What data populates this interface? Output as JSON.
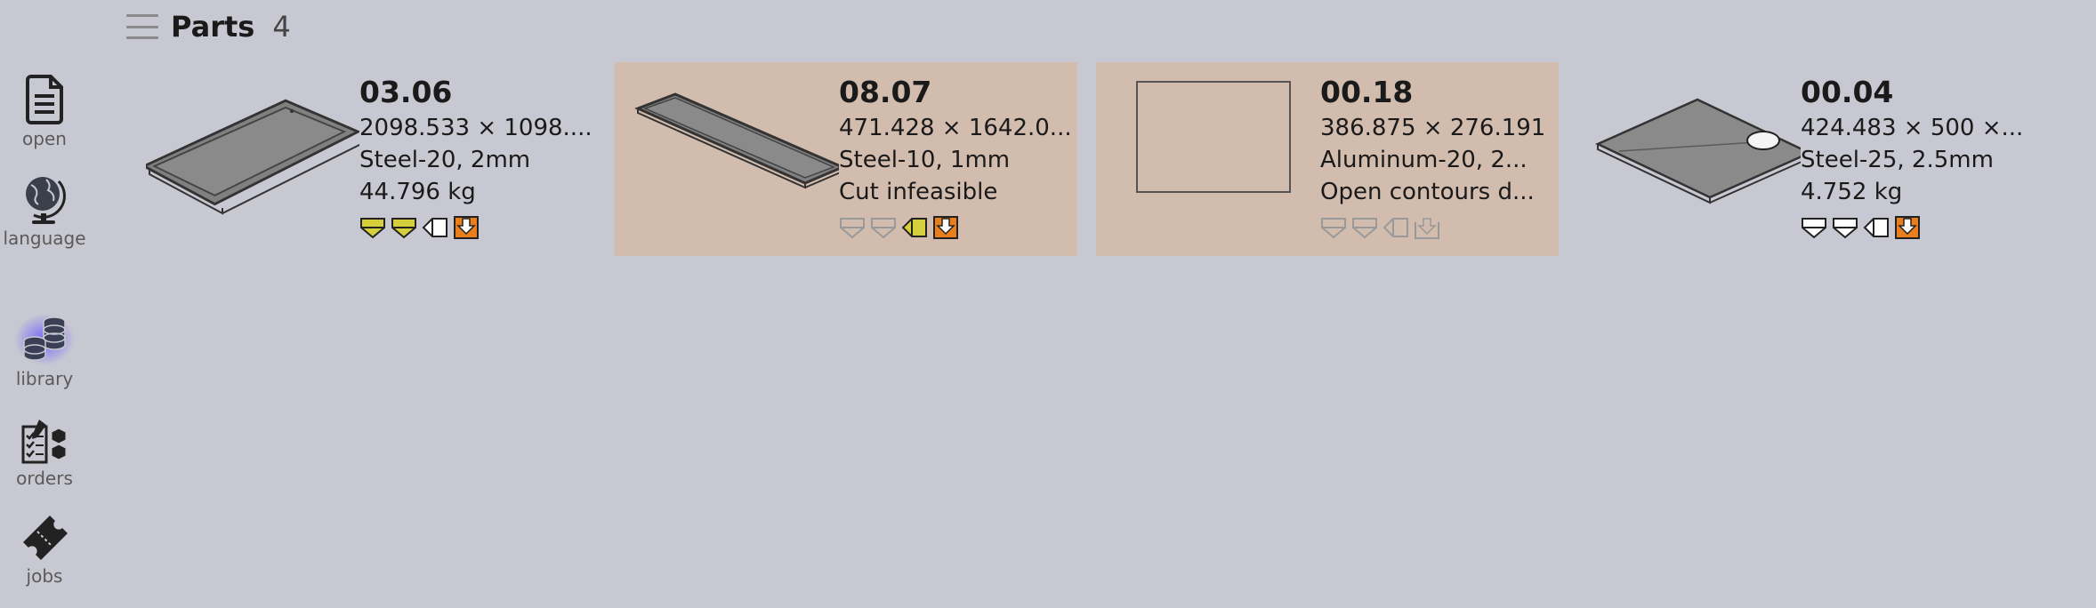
{
  "sidebar": {
    "items": [
      {
        "label": "open",
        "icon": "document-icon"
      },
      {
        "label": "language",
        "icon": "globe-icon"
      },
      {
        "label": "library",
        "icon": "database-stack-icon"
      },
      {
        "label": "orders",
        "icon": "orders-checklist-icon"
      },
      {
        "label": "jobs",
        "icon": "ticket-icon"
      }
    ]
  },
  "header": {
    "title": "Parts",
    "count": "4"
  },
  "parts": [
    {
      "name": "03.06",
      "dims": "2098.533 × 1098....",
      "material": "Steel-20, 2mm",
      "status": "44.796 kg",
      "selected": false,
      "icons": [
        "bend-yellow",
        "bend-yellow",
        "tag-white",
        "download-orange"
      ]
    },
    {
      "name": "08.07",
      "dims": "471.428 × 1642.0...",
      "material": "Steel-10, 1mm",
      "status": "Cut infeasible",
      "selected": true,
      "icons": [
        "bend-disabled",
        "bend-disabled",
        "tag-yellow",
        "download-orange"
      ]
    },
    {
      "name": "00.18",
      "dims": "386.875 × 276.191",
      "material": "Aluminum-20, 2...",
      "status": "Open contours d...",
      "selected": true,
      "icons": [
        "bend-disabled",
        "bend-disabled",
        "tag-disabled",
        "download-disabled"
      ]
    },
    {
      "name": "00.04",
      "dims": "424.483 × 500 ×...",
      "material": "Steel-25, 2.5mm",
      "status": "4.752 kg",
      "selected": false,
      "icons": [
        "bend-white",
        "bend-white",
        "tag-white",
        "download-orange"
      ]
    }
  ],
  "colors": {
    "background": "#c8c8d2",
    "selected_card": "#d2bcae",
    "icon_yellow": "#d4cf3a",
    "icon_orange": "#e87f1c",
    "library_glow": "#6a5cff"
  }
}
